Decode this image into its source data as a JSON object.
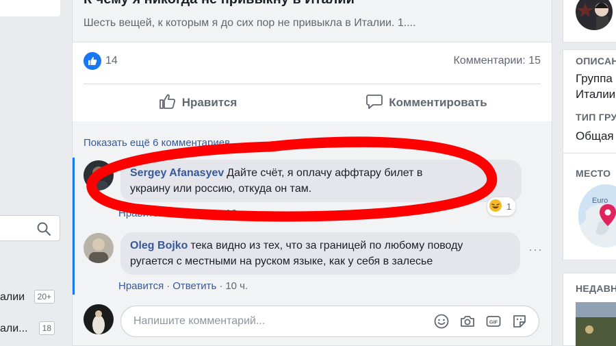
{
  "post": {
    "link_title": "К чему я никогда не привыкну в Италии",
    "link_description": "Шесть вещей, к которым я до сих пор не привыкла в Италии. 1....",
    "reaction_count": "14",
    "comments_count": "Комментарии: 15",
    "actions": {
      "like": "Нравится",
      "comment": "Комментировать"
    },
    "show_more": "Показать ещё 6 комментариев"
  },
  "comments": [
    {
      "author": "Sergey Afanasyev",
      "text_line1": "Дайте счёт, я оплачу аффтару билет в",
      "text_line2": "украину или россию, откуда он там.",
      "like": "Нравится",
      "reply": "Ответить",
      "separator": "·",
      "time": "16 ч.",
      "reaction_count": "1"
    },
    {
      "author": "Oleg Bojko",
      "text_line1": "тека видно из тех, что за границей по любому поводу",
      "text_line2": "ругается с местными на руском языке, как у себя в залесье",
      "like": "Нравится",
      "reply": "Ответить",
      "separator": "·",
      "time": "10 ч."
    }
  ],
  "write_comment": {
    "placeholder": "Напишите комментарий..."
  },
  "left_sidebar": {
    "items": [
      {
        "label": "алии",
        "badge": "20+"
      },
      {
        "label": "али...",
        "badge": "18"
      }
    ]
  },
  "right_sidebar": {
    "description_label": "ОПИСАН",
    "description_line1": "Группа",
    "description_line2": "Италии",
    "type_label": "ТИП ГРУ",
    "type_value": "Общая",
    "location_label": "МЕСТО",
    "map_label": "Euro",
    "recent_label": "НЕДАВН"
  },
  "colors": {
    "accent": "#1877f2",
    "link": "#385898",
    "annotation": "#ff0000"
  }
}
